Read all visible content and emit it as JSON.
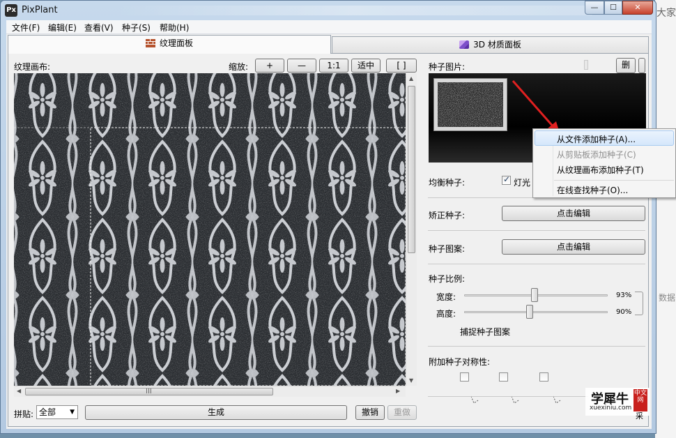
{
  "background": {
    "text_top": "大家",
    "text_mid": "数据"
  },
  "window": {
    "title": "PixPlant",
    "icon_label": "Px",
    "controls": {
      "minimize": "—",
      "maximize": "☐",
      "close": "✕"
    }
  },
  "menu": [
    "文件(F)",
    "编辑(E)",
    "查看(V)",
    "种子(S)",
    "帮助(H)"
  ],
  "tabs": [
    {
      "label": "纹理面板",
      "icon": "brick-icon",
      "active": true
    },
    {
      "label": "3D 材质面板",
      "icon": "cube-icon",
      "active": false
    }
  ],
  "left": {
    "canvas_label": "纹理画布:",
    "zoom_label": "缩放:",
    "zoom_buttons": [
      "+",
      "—",
      "1:1",
      "适中",
      "[ ]"
    ],
    "tile_label": "拼贴:",
    "tile_value": "全部",
    "generate_label": "生成",
    "undo_label": "撤销",
    "redo_label": "重做",
    "scroll_mid": "III"
  },
  "right": {
    "seed_image_label": "种子图片:",
    "delete_label": "删",
    "balance_label": "均衡种子:",
    "light_label": "灯光",
    "light_checked": true,
    "straighten_label": "矫正种子:",
    "straighten_button": "点击编辑",
    "pattern_label": "种子图案:",
    "pattern_button": "点击编辑",
    "ratio_label": "种子比例:",
    "width_label": "宽度:",
    "width_value": "93%",
    "width_fraction": 0.93,
    "height_label": "高度:",
    "height_value": "90%",
    "height_fraction": 0.9,
    "capture_label": "捕捉种子图案",
    "symmetry_label": "附加种子对称性:"
  },
  "context_menu": [
    {
      "label": "从文件添加种子(A)...",
      "enabled": true,
      "highlighted": true
    },
    {
      "label": "从剪贴板添加种子(C)",
      "enabled": false,
      "highlighted": false
    },
    {
      "label": "从纹理画布添加种子(T)",
      "enabled": true,
      "highlighted": false
    },
    {
      "label": "在线查找种子(O)...",
      "enabled": true,
      "highlighted": false
    }
  ],
  "watermark": {
    "main": "学犀牛",
    "sub": "xuexiniu.com",
    "seal": "中文网",
    "overflow": "采"
  },
  "colors": {
    "accent_arrow": "#e02020",
    "selection": "#d5e7fb"
  }
}
